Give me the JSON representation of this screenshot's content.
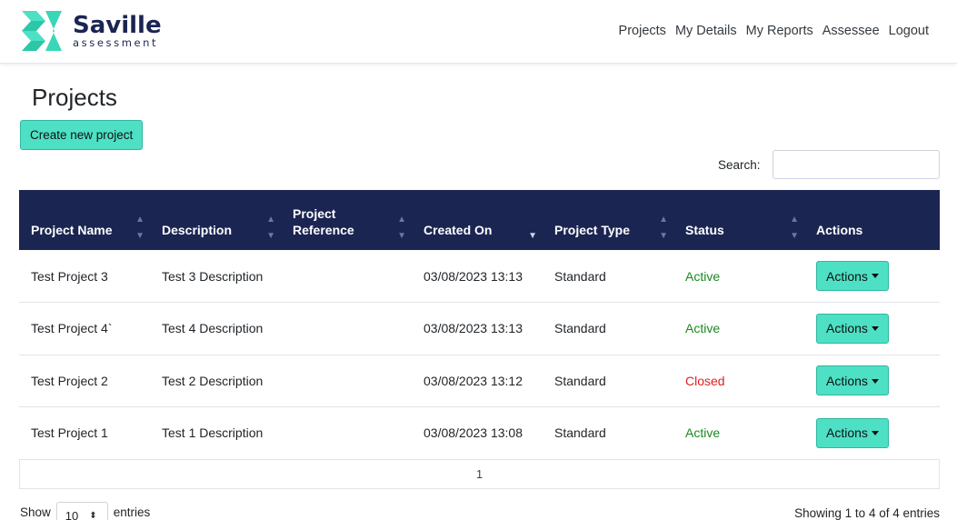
{
  "brand": {
    "name": "Saville",
    "subtitle": "assessment",
    "colors": {
      "navy": "#1b2552",
      "teal": "#4de0c5",
      "green": "#22b14c"
    }
  },
  "nav": {
    "items": [
      "Projects",
      "My Details",
      "My Reports",
      "Assessee",
      "Logout"
    ]
  },
  "page": {
    "title": "Projects",
    "create_button": "Create new project"
  },
  "search": {
    "label": "Search:",
    "value": ""
  },
  "table": {
    "columns": [
      {
        "label": "Project Name",
        "sort_icon": "sort-both-icon"
      },
      {
        "label": "Description",
        "sort_icon": "sort-both-icon"
      },
      {
        "label": "Project Reference",
        "sort_icon": "sort-both-icon"
      },
      {
        "label": "Created On",
        "sort_icon": "sort-desc-icon"
      },
      {
        "label": "Project Type",
        "sort_icon": "sort-both-icon"
      },
      {
        "label": "Status",
        "sort_icon": "sort-both-icon"
      },
      {
        "label": "Actions",
        "sort_icon": ""
      }
    ],
    "rows": [
      {
        "name": "Test Project 3",
        "description": "Test 3 Description",
        "reference": "",
        "created": "03/08/2023 13:13",
        "type": "Standard",
        "status": "Active",
        "action": "Actions"
      },
      {
        "name": "Test Project 4`",
        "description": "Test 4 Description",
        "reference": "",
        "created": "03/08/2023 13:13",
        "type": "Standard",
        "status": "Active",
        "action": "Actions"
      },
      {
        "name": "Test Project 2",
        "description": "Test 2 Description",
        "reference": "",
        "created": "03/08/2023 13:12",
        "type": "Standard",
        "status": "Closed",
        "action": "Actions"
      },
      {
        "name": "Test Project 1",
        "description": "Test 1 Description",
        "reference": "",
        "created": "03/08/2023 13:08",
        "type": "Standard",
        "status": "Active",
        "action": "Actions"
      }
    ],
    "status_colors": {
      "Active": "#198a1f",
      "Closed": "#e02020"
    }
  },
  "pagination": {
    "current_page": "1"
  },
  "footer": {
    "show_label": "Show",
    "entries_value": "10",
    "entries_label": "entries",
    "info": "Showing 1 to 4 of 4 entries"
  }
}
